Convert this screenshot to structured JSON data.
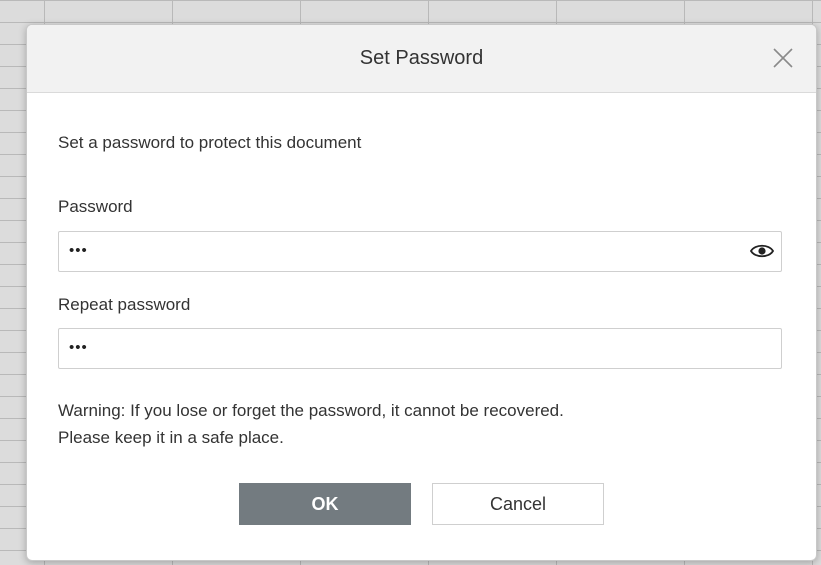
{
  "dialog": {
    "title": "Set Password",
    "description": "Set a password to protect this document",
    "password_label": "Password",
    "password_value": "•••",
    "repeat_label": "Repeat password",
    "repeat_value": "•••",
    "warning_line1": "Warning: If you lose or forget the password, it cannot be recovered.",
    "warning_line2": "Please keep it in a safe place.",
    "ok_label": "OK",
    "cancel_label": "Cancel"
  },
  "icons": {
    "close": "close-icon",
    "show_password": "eye-icon"
  },
  "colors": {
    "ok_button": "#737b80",
    "header_bg": "#f2f2f2",
    "backdrop": "#dcdcdc"
  }
}
